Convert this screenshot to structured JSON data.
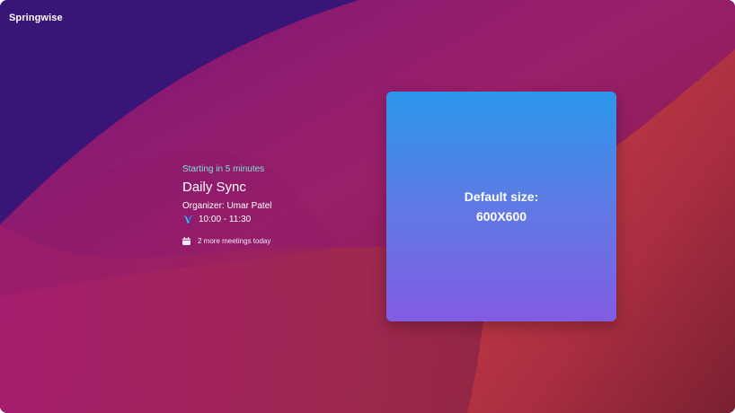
{
  "brand": {
    "name": "Springwise"
  },
  "meeting": {
    "status": "Starting in 5 minutes",
    "title": "Daily Sync",
    "organizer": "Organizer: Umar Patel",
    "time": "10:00 - 11:30",
    "more": "2 more meetings today"
  },
  "tile": {
    "line1": "Default size:",
    "line2": "600X600"
  },
  "icons": {
    "meeting_app": "webex-icon",
    "calendar": "calendar-icon"
  },
  "colors": {
    "accent_text": "#7fe3d1",
    "background_purple": "#3a1578",
    "background_magenta": "#a0236a",
    "background_red": "#c23a46",
    "tile_top": "#2a97ea",
    "tile_bottom": "#815be2"
  }
}
